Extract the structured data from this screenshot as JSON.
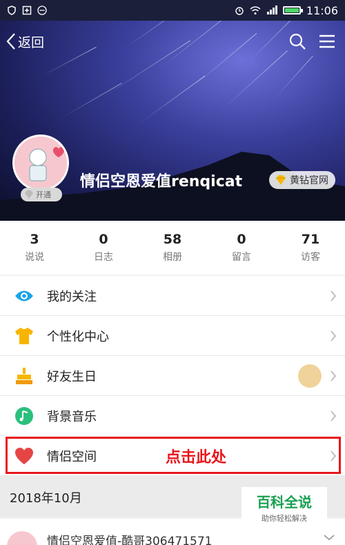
{
  "status_bar": {
    "time": "11:06"
  },
  "nav": {
    "back_label": "返回"
  },
  "profile": {
    "username": "情侣空恩爱值renqicat",
    "open_badge": "开通",
    "yellow_diamond_label": "黄钻官网"
  },
  "stats": [
    {
      "value": "3",
      "label": "说说"
    },
    {
      "value": "0",
      "label": "日志"
    },
    {
      "value": "58",
      "label": "相册"
    },
    {
      "value": "0",
      "label": "留言"
    },
    {
      "value": "71",
      "label": "访客"
    }
  ],
  "menu": [
    {
      "label": "我的关注",
      "icon": "eye-icon"
    },
    {
      "label": "个性化中心",
      "icon": "tshirt-icon"
    },
    {
      "label": "好友生日",
      "icon": "cake-icon"
    },
    {
      "label": "背景音乐",
      "icon": "music-icon"
    },
    {
      "label": "情侣空间",
      "icon": "heart-icon"
    }
  ],
  "annotation": {
    "text": "点击此处"
  },
  "feed": {
    "month": "2018年10月",
    "item_text": "情侣空恩爱值-酷哥306471571"
  },
  "watermark": {
    "title": "百科全说",
    "subtitle": "助你轻松解决"
  },
  "colors": {
    "highlight": "#e8161c",
    "accent_blue": "#1aa3e8",
    "accent_yellow": "#f7b500",
    "accent_green": "#2bc07c",
    "heart_red": "#e64545"
  }
}
